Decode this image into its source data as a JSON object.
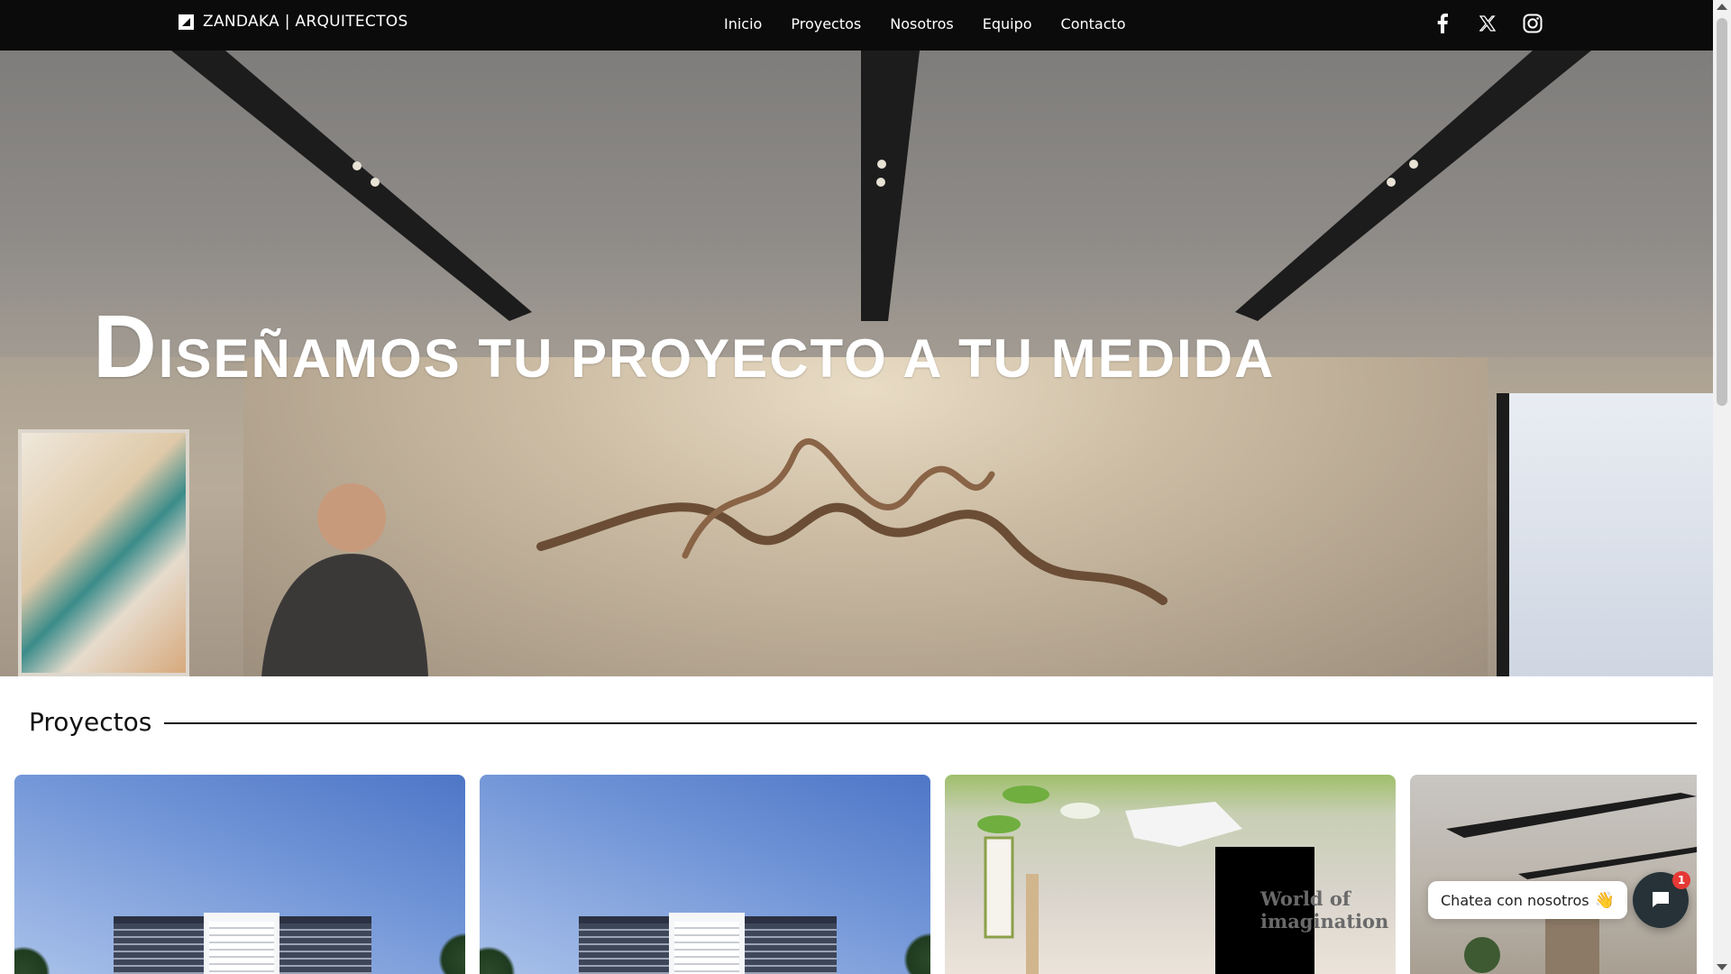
{
  "header": {
    "brand": "ZANDAKA | ARQUITECTOS",
    "nav": [
      {
        "label": "Inicio"
      },
      {
        "label": "Proyectos"
      },
      {
        "label": "Nosotros"
      },
      {
        "label": "Equipo"
      },
      {
        "label": "Contacto"
      }
    ],
    "socials": [
      {
        "icon": "facebook-icon"
      },
      {
        "icon": "x-twitter-icon"
      },
      {
        "icon": "instagram-icon"
      }
    ]
  },
  "hero": {
    "title_first_letter": "D",
    "title_rest": "iseñamos tu proyecto a tu medida"
  },
  "projects": {
    "heading": "Proyectos",
    "cards": [
      {
        "image": "residential-tower-render"
      },
      {
        "image": "residential-tower-render"
      },
      {
        "image": "kids-room-render",
        "wall_text": "World of imagination"
      },
      {
        "image": "office-interior-render"
      }
    ]
  },
  "chat": {
    "prompt": "Chatea con nosotros",
    "emoji": "👋",
    "badge_count": "1"
  },
  "colors": {
    "navbar_bg": "#0b0b0b",
    "chat_button": "#263238",
    "badge": "#e53935"
  }
}
